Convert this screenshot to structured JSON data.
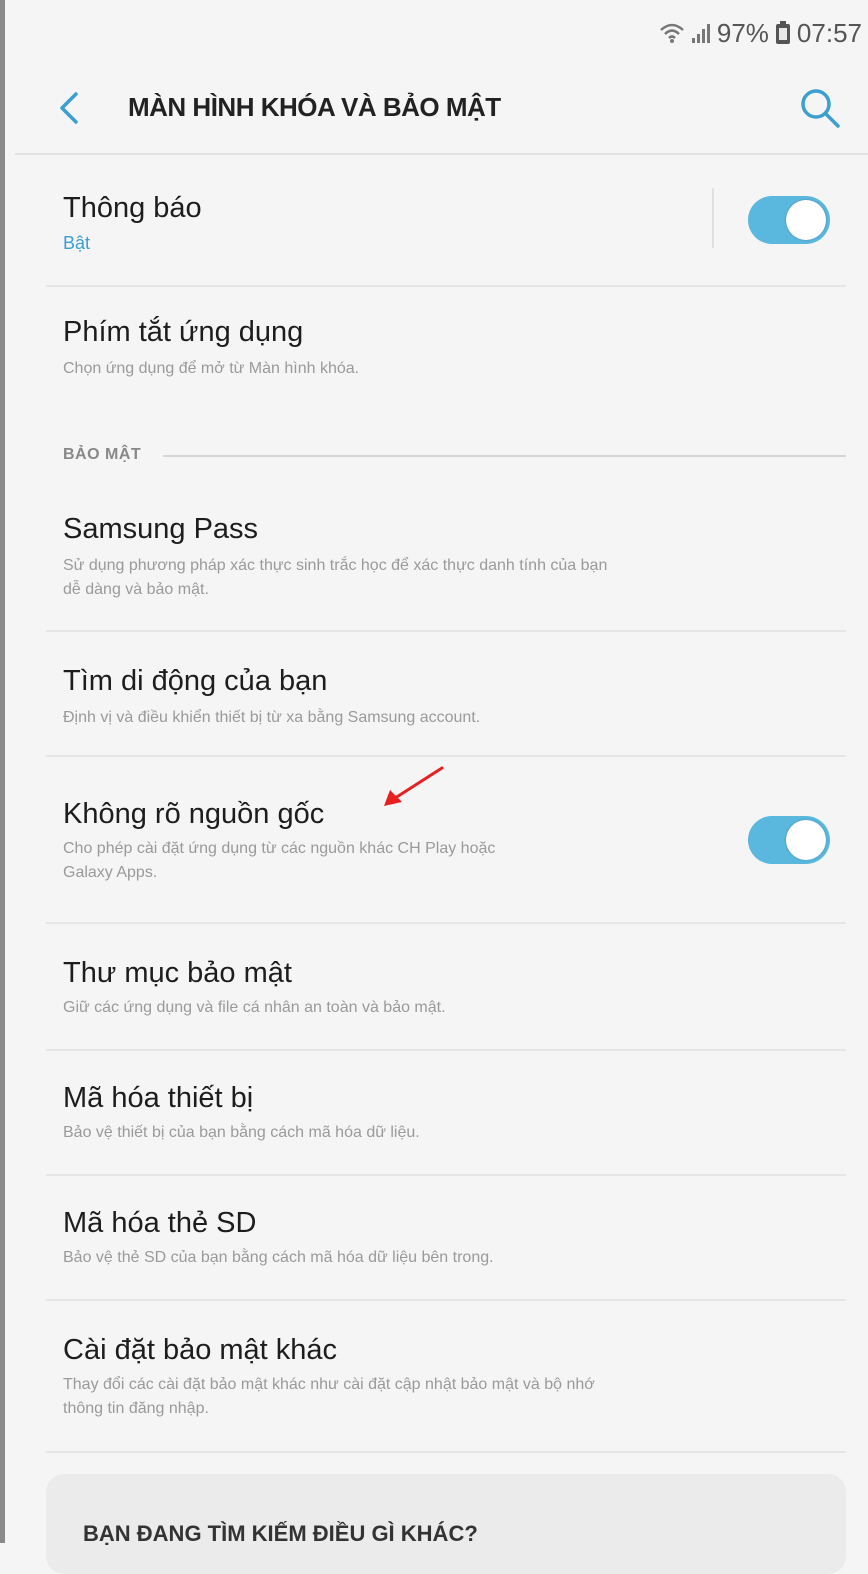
{
  "status_bar": {
    "battery": "97%",
    "time": "07:57"
  },
  "header": {
    "title": "MÀN HÌNH KHÓA VÀ BẢO MẬT"
  },
  "items_top": [
    {
      "title": "Thông báo",
      "subtitle": "Bật",
      "toggle": true
    },
    {
      "title": "Phím tắt ứng dụng",
      "subtitle": "Chọn ứng dụng để mở từ Màn hình khóa."
    }
  ],
  "section": {
    "label": "BẢO MẬT"
  },
  "items_security": [
    {
      "title": "Samsung Pass",
      "subtitle1": "Sử dụng phương pháp xác thực sinh trắc học để xác thực danh tính của bạn",
      "subtitle2": "dễ dàng và bảo mật."
    },
    {
      "title": "Tìm di động của bạn",
      "subtitle": "Định vị và điều khiển thiết bị từ xa bằng Samsung account."
    },
    {
      "title": "Không rõ nguồn gốc",
      "subtitle1": "Cho phép cài đặt ứng dụng từ các nguồn khác CH Play hoặc",
      "subtitle2": "Galaxy Apps.",
      "toggle": true
    },
    {
      "title": "Thư mục bảo mật",
      "subtitle": "Giữ các ứng dụng và file cá nhân an toàn và bảo mật."
    },
    {
      "title": "Mã hóa thiết bị",
      "subtitle": "Bảo vệ thiết bị của bạn bằng cách mã hóa dữ liệu."
    },
    {
      "title": "Mã hóa thẻ SD",
      "subtitle": "Bảo vệ thẻ SD của bạn bằng cách mã hóa dữ liệu bên trong."
    },
    {
      "title": "Cài đặt bảo mật khác",
      "subtitle1": "Thay đổi các cài đặt bảo mật khác như cài đặt cập nhật bảo mật và bộ nhớ",
      "subtitle2": "thông tin đăng nhập."
    }
  ],
  "card": {
    "title": "BẠN ĐANG TÌM KIẾM ĐIỀU GÌ KHÁC?"
  },
  "colors": {
    "accent": "#3b9fd0",
    "toggle_on": "#5ab8de",
    "arrow": "#e8201f"
  },
  "icons": {
    "back": "chevron-left-icon",
    "search": "search-icon",
    "wifi": "wifi-icon",
    "signal": "signal-icon",
    "battery": "battery-icon"
  }
}
